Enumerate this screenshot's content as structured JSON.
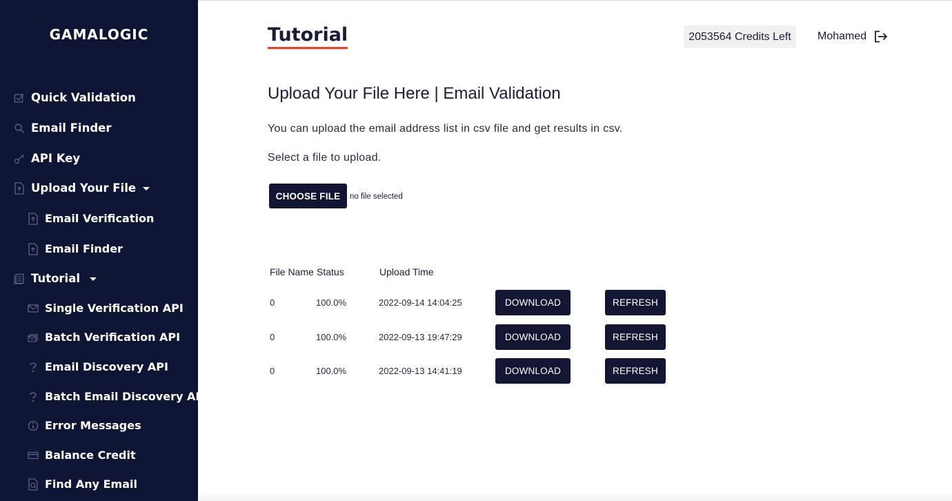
{
  "brand": "GAMALOGIC",
  "sidebar": {
    "items": [
      {
        "label": "Quick Validation",
        "icon": "checkbox-icon"
      },
      {
        "label": "Email Finder",
        "icon": "search-icon"
      },
      {
        "label": "API Key",
        "icon": "key-icon"
      },
      {
        "label": "Upload Your File",
        "icon": "file-upload-icon",
        "expanded": true
      },
      {
        "label": "Email Verification",
        "icon": "file-upload-icon"
      },
      {
        "label": "Email Finder",
        "icon": "file-upload-icon"
      },
      {
        "label": "Tutorial",
        "icon": "document-icon",
        "expanded": true
      },
      {
        "label": "Single Verification API",
        "icon": "envelope-icon"
      },
      {
        "label": "Batch Verification API",
        "icon": "stack-icon"
      },
      {
        "label": "Email Discovery API",
        "icon": "question-icon"
      },
      {
        "label": "Batch Email Discovery API",
        "icon": "question-icon"
      },
      {
        "label": "Error Messages",
        "icon": "info-icon"
      },
      {
        "label": "Balance Credit",
        "icon": "card-icon"
      },
      {
        "label": "Find Any Email",
        "icon": "file-search-icon"
      }
    ]
  },
  "header": {
    "tutorial_link": "Tutorial",
    "credits": "2053564 Credits Left",
    "user": "Mohamed",
    "accent_color": "#e0452f"
  },
  "main": {
    "title": "Upload Your File Here | Email Validation",
    "description": "You can upload the email address list in csv file and get results in csv.",
    "select_prompt": "Select a file to upload.",
    "choose_file_label": "CHOOSE FILE",
    "no_file_text": "no file selected"
  },
  "table": {
    "headers": [
      "File Name",
      "Status",
      "Upload Time"
    ],
    "rows": [
      {
        "file_name": "0",
        "status": "100.0%",
        "upload_time": "2022-09-14 14:04:25",
        "download_label": "DOWNLOAD",
        "refresh_label": "REFRESH"
      },
      {
        "file_name": "0",
        "status": "100.0%",
        "upload_time": "2022-09-13 19:47:29",
        "download_label": "DOWNLOAD",
        "refresh_label": "REFRESH"
      },
      {
        "file_name": "0",
        "status": "100.0%",
        "upload_time": "2022-09-13 14:41:19",
        "download_label": "DOWNLOAD",
        "refresh_label": "REFRESH"
      }
    ]
  },
  "colors": {
    "sidebar_bg": "#0f1534",
    "button_bg": "#131633"
  }
}
